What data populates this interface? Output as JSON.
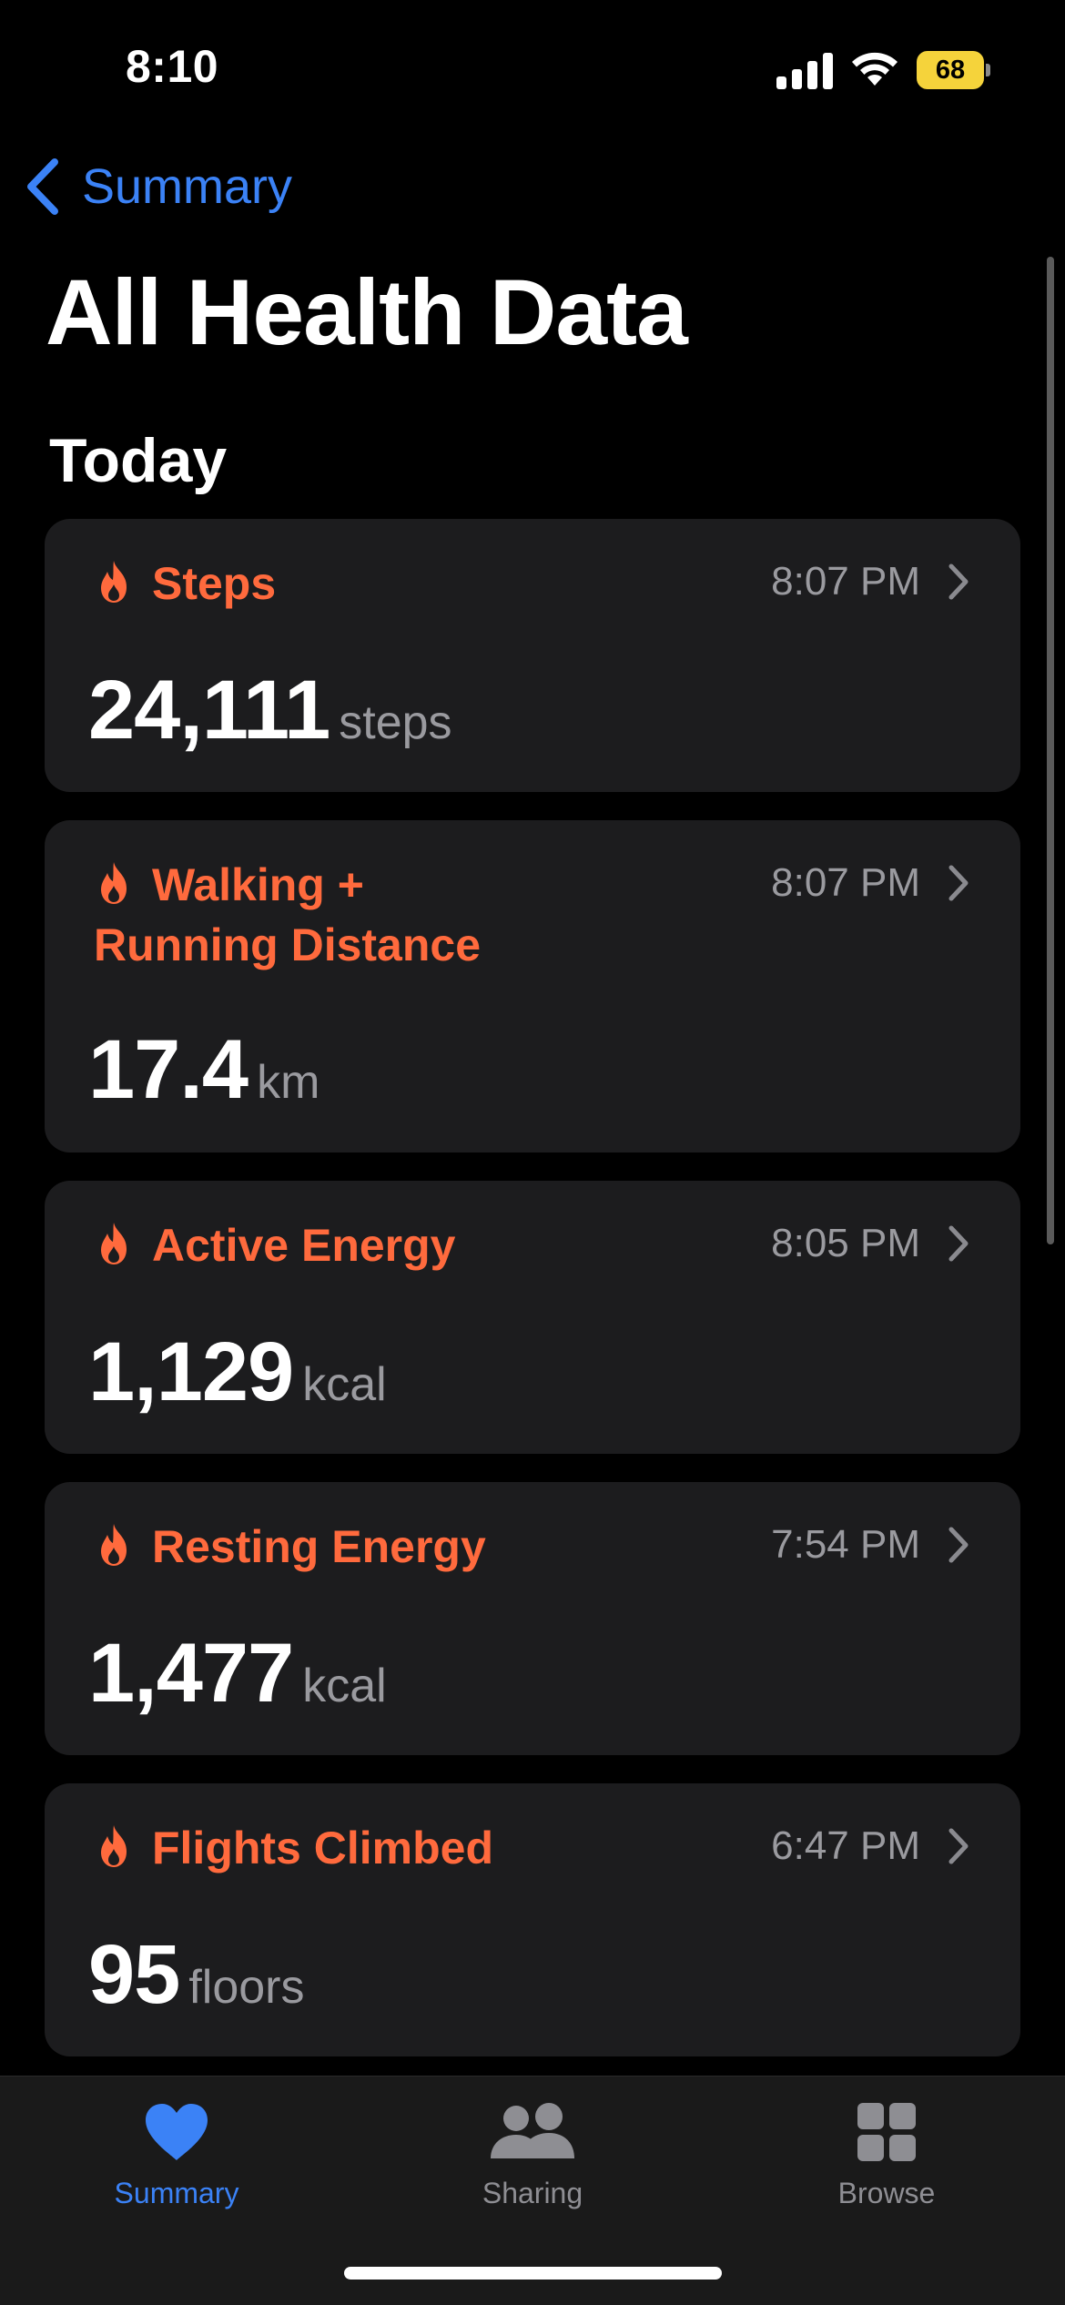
{
  "status_bar": {
    "time": "8:10",
    "battery_level": "68",
    "battery_color": "#f5d33b"
  },
  "nav": {
    "back_label": "Summary"
  },
  "page_title": "All Health Data",
  "section_title": "Today",
  "accent_colors": {
    "link_blue": "#3b82f6",
    "metric_orange": "#ff6a3d"
  },
  "cards": [
    {
      "title": "Steps",
      "time": "8:07 PM",
      "value": "24,111",
      "unit": "steps",
      "icon": "flame-icon"
    },
    {
      "title": "Walking + Running Distance",
      "time": "8:07 PM",
      "value": "17.4",
      "unit": "km",
      "icon": "flame-icon"
    },
    {
      "title": "Active Energy",
      "time": "8:05 PM",
      "value": "1,129",
      "unit": "kcal",
      "icon": "flame-icon"
    },
    {
      "title": "Resting Energy",
      "time": "7:54 PM",
      "value": "1,477",
      "unit": "kcal",
      "icon": "flame-icon"
    },
    {
      "title": "Flights Climbed",
      "time": "6:47 PM",
      "value": "95",
      "unit": "floors",
      "icon": "flame-icon"
    }
  ],
  "tab_bar": {
    "tabs": [
      {
        "label": "Summary",
        "icon": "heart-icon",
        "active": true
      },
      {
        "label": "Sharing",
        "icon": "people-icon",
        "active": false
      },
      {
        "label": "Browse",
        "icon": "grid-icon",
        "active": false
      }
    ]
  }
}
